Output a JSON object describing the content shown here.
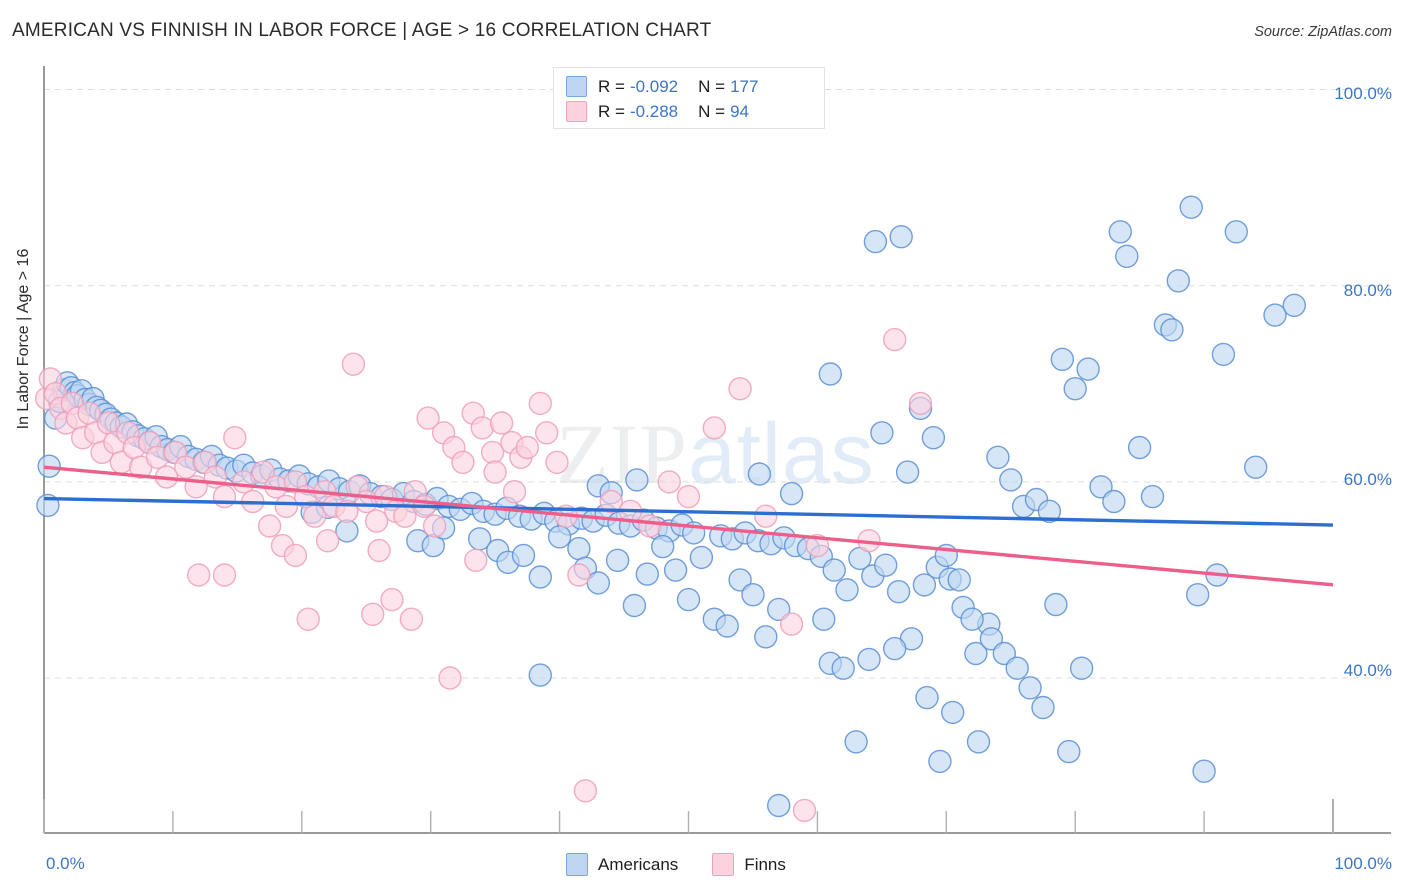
{
  "header": {
    "title": "AMERICAN VS FINNISH IN LABOR FORCE | AGE > 16 CORRELATION CHART",
    "source": "Source: ZipAtlas.com"
  },
  "watermark": {
    "part1": "ZIP",
    "part2": "atlas"
  },
  "correlation_legend": {
    "rows": [
      {
        "series": "Americans",
        "r_label": "R =",
        "r_value": "-0.092",
        "n_label": "N =",
        "n_value": "177",
        "color": "#bed6f2"
      },
      {
        "series": "Finns",
        "r_label": "R =",
        "r_value": "-0.288",
        "n_label": "N =",
        "n_value": "94",
        "color": "#fbd2de"
      }
    ]
  },
  "bottom_legend": {
    "items": [
      {
        "label": "Americans",
        "fill": "#bed6f2",
        "stroke": "#7aa7db"
      },
      {
        "label": "Finns",
        "fill": "#fbd2de",
        "stroke": "#eda3bb"
      }
    ]
  },
  "axes": {
    "y_title": "In Labor Force | Age > 16",
    "y_ticks": [
      "100.0%",
      "80.0%",
      "60.0%",
      "40.0%"
    ],
    "x_min_label": "0.0%",
    "x_max_label": "100.0%"
  },
  "chart_data": {
    "type": "scatter",
    "title": "AMERICAN VS FINNISH IN LABOR FORCE | AGE > 16 CORRELATION CHART",
    "xlabel": "",
    "ylabel": "In Labor Force | Age > 16",
    "xlim": [
      0,
      100
    ],
    "ylim": [
      24.2,
      102.4
    ],
    "x_ticks": [
      0,
      100
    ],
    "y_ticks": [
      40,
      60,
      80,
      100
    ],
    "grid": true,
    "legend_position": "bottom",
    "colors": {
      "americans_fill": "#bed6f2",
      "americans_stroke": "#5b8fd4",
      "finns_fill": "#fbd2de",
      "finns_stroke": "#ef9fba",
      "americans_trend": "#2c6fd1",
      "finns_trend": "#ec5f8b",
      "axis_text": "#3b76c4",
      "grid": "#dddddd"
    },
    "series": [
      {
        "name": "Americans",
        "r": -0.092,
        "n": 177,
        "trendline": {
          "x0": 0,
          "y0": 58.3,
          "x1": 100,
          "y1": 55.6
        },
        "points": [
          [
            0.3,
            57.6
          ],
          [
            0.4,
            61.6
          ],
          [
            0.9,
            66.5
          ],
          [
            1.2,
            68.2
          ],
          [
            1.5,
            69.4
          ],
          [
            1.8,
            70.1
          ],
          [
            2.1,
            69.6
          ],
          [
            2.4,
            69.1
          ],
          [
            2.6,
            68.8
          ],
          [
            2.9,
            69.3
          ],
          [
            3.2,
            68.4
          ],
          [
            3.5,
            67.9
          ],
          [
            3.8,
            68.5
          ],
          [
            4.1,
            67.6
          ],
          [
            4.4,
            67.3
          ],
          [
            4.8,
            66.9
          ],
          [
            5.2,
            66.4
          ],
          [
            5.6,
            66.0
          ],
          [
            6.0,
            65.6
          ],
          [
            6.4,
            65.9
          ],
          [
            6.9,
            65.1
          ],
          [
            7.3,
            64.7
          ],
          [
            7.8,
            64.4
          ],
          [
            8.2,
            64.0
          ],
          [
            8.7,
            64.6
          ],
          [
            9.1,
            63.6
          ],
          [
            9.6,
            63.3
          ],
          [
            10.1,
            63.0
          ],
          [
            10.6,
            63.6
          ],
          [
            11.2,
            62.6
          ],
          [
            11.8,
            62.3
          ],
          [
            12.4,
            62.0
          ],
          [
            13.0,
            62.6
          ],
          [
            13.6,
            61.7
          ],
          [
            14.2,
            61.4
          ],
          [
            14.9,
            61.1
          ],
          [
            15.5,
            61.7
          ],
          [
            16.2,
            60.9
          ],
          [
            16.9,
            60.6
          ],
          [
            17.6,
            61.2
          ],
          [
            18.3,
            60.3
          ],
          [
            19.0,
            60.1
          ],
          [
            19.8,
            60.6
          ],
          [
            20.5,
            59.8
          ],
          [
            21.3,
            59.5
          ],
          [
            22.1,
            60.1
          ],
          [
            22.9,
            59.3
          ],
          [
            23.7,
            59.0
          ],
          [
            24.5,
            59.6
          ],
          [
            25.3,
            58.8
          ],
          [
            20.8,
            56.9
          ],
          [
            22.0,
            57.4
          ],
          [
            23.5,
            55.0
          ],
          [
            26.2,
            58.5
          ],
          [
            27.0,
            58.2
          ],
          [
            27.9,
            58.8
          ],
          [
            28.7,
            58.0
          ],
          [
            29.6,
            57.7
          ],
          [
            30.5,
            58.3
          ],
          [
            31.4,
            57.5
          ],
          [
            32.3,
            57.2
          ],
          [
            33.2,
            57.8
          ],
          [
            34.1,
            57.0
          ],
          [
            35.0,
            56.7
          ],
          [
            35.9,
            57.3
          ],
          [
            36.9,
            56.5
          ],
          [
            37.8,
            56.2
          ],
          [
            38.8,
            56.8
          ],
          [
            39.7,
            56.0
          ],
          [
            40.7,
            55.7
          ],
          [
            29.0,
            54.0
          ],
          [
            30.2,
            53.5
          ],
          [
            31.0,
            55.3
          ],
          [
            33.8,
            54.2
          ],
          [
            35.2,
            53.0
          ],
          [
            36.0,
            51.8
          ],
          [
            37.2,
            52.5
          ],
          [
            38.5,
            50.3
          ],
          [
            40.0,
            54.4
          ],
          [
            41.5,
            53.2
          ],
          [
            41.7,
            56.3
          ],
          [
            42.6,
            56.0
          ],
          [
            43.6,
            56.6
          ],
          [
            44.6,
            55.8
          ],
          [
            45.5,
            55.5
          ],
          [
            46.5,
            56.1
          ],
          [
            47.5,
            55.3
          ],
          [
            48.5,
            55.0
          ],
          [
            49.5,
            55.6
          ],
          [
            50.4,
            54.8
          ],
          [
            42.0,
            51.2
          ],
          [
            43.0,
            49.7
          ],
          [
            44.5,
            52.0
          ],
          [
            45.8,
            47.4
          ],
          [
            46.8,
            50.6
          ],
          [
            48.0,
            53.4
          ],
          [
            49.0,
            51.0
          ],
          [
            50.0,
            48.0
          ],
          [
            51.0,
            52.3
          ],
          [
            52.0,
            46.0
          ],
          [
            38.5,
            40.3
          ],
          [
            43.0,
            59.6
          ],
          [
            44.0,
            58.9
          ],
          [
            46.0,
            60.2
          ],
          [
            52.5,
            54.5
          ],
          [
            53.4,
            54.2
          ],
          [
            54.4,
            54.8
          ],
          [
            55.4,
            54.0
          ],
          [
            56.4,
            53.7
          ],
          [
            57.4,
            54.3
          ],
          [
            53.0,
            45.3
          ],
          [
            54.0,
            50.0
          ],
          [
            55.0,
            48.5
          ],
          [
            56.0,
            44.2
          ],
          [
            57.0,
            47.0
          ],
          [
            58.3,
            53.5
          ],
          [
            59.3,
            53.2
          ],
          [
            60.3,
            52.4
          ],
          [
            61.3,
            51.0
          ],
          [
            62.3,
            49.0
          ],
          [
            55.5,
            60.8
          ],
          [
            58.0,
            58.8
          ],
          [
            60.5,
            46.0
          ],
          [
            61.0,
            41.5
          ],
          [
            62.0,
            41.0
          ],
          [
            63.3,
            52.2
          ],
          [
            64.3,
            50.4
          ],
          [
            65.3,
            51.5
          ],
          [
            66.3,
            48.8
          ],
          [
            67.3,
            44.0
          ],
          [
            57.0,
            27.0
          ],
          [
            63.0,
            33.5
          ],
          [
            64.0,
            41.9
          ],
          [
            66.0,
            43.0
          ],
          [
            68.3,
            49.5
          ],
          [
            69.3,
            51.3
          ],
          [
            70.3,
            50.1
          ],
          [
            71.3,
            47.2
          ],
          [
            72.3,
            42.5
          ],
          [
            73.3,
            45.5
          ],
          [
            61.0,
            71.0
          ],
          [
            64.5,
            84.5
          ],
          [
            66.5,
            85.0
          ],
          [
            65.0,
            65.0
          ],
          [
            67.0,
            61.0
          ],
          [
            68.0,
            67.5
          ],
          [
            69.0,
            64.5
          ],
          [
            70.0,
            52.5
          ],
          [
            71.0,
            50.0
          ],
          [
            72.0,
            46.0
          ],
          [
            68.5,
            38.0
          ],
          [
            69.5,
            31.5
          ],
          [
            70.5,
            36.5
          ],
          [
            72.5,
            33.5
          ],
          [
            73.5,
            44.0
          ],
          [
            74.0,
            62.5
          ],
          [
            75.0,
            60.2
          ],
          [
            76.0,
            57.5
          ],
          [
            77.0,
            58.2
          ],
          [
            78.0,
            57.0
          ],
          [
            74.5,
            42.5
          ],
          [
            75.5,
            41.0
          ],
          [
            76.5,
            39.0
          ],
          [
            77.5,
            37.0
          ],
          [
            78.5,
            47.5
          ],
          [
            79.0,
            72.5
          ],
          [
            80.0,
            69.5
          ],
          [
            81.0,
            71.5
          ],
          [
            82.0,
            59.5
          ],
          [
            83.0,
            58.0
          ],
          [
            79.5,
            32.5
          ],
          [
            80.5,
            41.0
          ],
          [
            83.5,
            85.5
          ],
          [
            84.0,
            83.0
          ],
          [
            85.0,
            63.5
          ],
          [
            86.0,
            58.5
          ],
          [
            87.0,
            76.0
          ],
          [
            87.5,
            75.5
          ],
          [
            88.0,
            80.5
          ],
          [
            89.0,
            88.0
          ],
          [
            90.0,
            30.5
          ],
          [
            91.0,
            50.5
          ],
          [
            91.5,
            73.0
          ],
          [
            92.5,
            85.5
          ],
          [
            94.0,
            61.5
          ],
          [
            95.5,
            77.0
          ],
          [
            97.0,
            78.0
          ],
          [
            89.5,
            48.5
          ]
        ]
      },
      {
        "name": "Finns",
        "r": -0.288,
        "n": 94,
        "trendline": {
          "x0": 0,
          "y0": 61.5,
          "x1": 100,
          "y1": 49.5
        },
        "points": [
          [
            0.2,
            68.5
          ],
          [
            0.5,
            70.5
          ],
          [
            0.9,
            69.0
          ],
          [
            1.3,
            67.5
          ],
          [
            1.7,
            66.0
          ],
          [
            2.2,
            68.0
          ],
          [
            2.6,
            66.5
          ],
          [
            3.0,
            64.5
          ],
          [
            3.5,
            67.0
          ],
          [
            4.0,
            65.0
          ],
          [
            4.5,
            63.0
          ],
          [
            5.0,
            66.0
          ],
          [
            5.5,
            64.0
          ],
          [
            6.0,
            62.0
          ],
          [
            6.5,
            65.0
          ],
          [
            7.0,
            63.5
          ],
          [
            7.5,
            61.5
          ],
          [
            8.2,
            64.0
          ],
          [
            8.8,
            62.5
          ],
          [
            9.5,
            60.5
          ],
          [
            10.2,
            63.0
          ],
          [
            11.0,
            61.5
          ],
          [
            11.8,
            59.5
          ],
          [
            12.5,
            62.0
          ],
          [
            13.3,
            60.5
          ],
          [
            14.0,
            58.5
          ],
          [
            14.8,
            64.5
          ],
          [
            15.5,
            60.0
          ],
          [
            16.2,
            58.0
          ],
          [
            17.0,
            61.0
          ],
          [
            12.0,
            50.5
          ],
          [
            14.0,
            50.5
          ],
          [
            17.5,
            55.5
          ],
          [
            18.0,
            59.5
          ],
          [
            18.8,
            57.5
          ],
          [
            19.5,
            60.0
          ],
          [
            20.3,
            58.5
          ],
          [
            21.0,
            56.5
          ],
          [
            21.8,
            59.0
          ],
          [
            22.5,
            57.5
          ],
          [
            18.5,
            53.5
          ],
          [
            19.5,
            52.5
          ],
          [
            20.5,
            46.0
          ],
          [
            22.0,
            54.0
          ],
          [
            23.5,
            57.0
          ],
          [
            24.3,
            59.5
          ],
          [
            25.0,
            58.0
          ],
          [
            25.8,
            56.0
          ],
          [
            26.5,
            58.5
          ],
          [
            27.3,
            57.0
          ],
          [
            24.0,
            72.0
          ],
          [
            25.5,
            46.5
          ],
          [
            26.0,
            53.0
          ],
          [
            27.0,
            48.0
          ],
          [
            28.0,
            56.5
          ],
          [
            28.8,
            59.0
          ],
          [
            29.5,
            57.5
          ],
          [
            30.3,
            55.5
          ],
          [
            31.0,
            65.0
          ],
          [
            31.8,
            63.5
          ],
          [
            28.5,
            46.0
          ],
          [
            29.8,
            66.5
          ],
          [
            31.5,
            40.0
          ],
          [
            32.5,
            62.0
          ],
          [
            33.3,
            67.0
          ],
          [
            34.0,
            65.5
          ],
          [
            34.8,
            63.0
          ],
          [
            35.5,
            66.0
          ],
          [
            36.3,
            64.0
          ],
          [
            37.0,
            62.5
          ],
          [
            33.5,
            52.0
          ],
          [
            35.0,
            61.0
          ],
          [
            36.5,
            59.0
          ],
          [
            37.5,
            63.5
          ],
          [
            38.5,
            68.0
          ],
          [
            39.0,
            65.0
          ],
          [
            39.8,
            62.0
          ],
          [
            40.5,
            56.5
          ],
          [
            41.5,
            50.5
          ],
          [
            42.0,
            28.5
          ],
          [
            44.0,
            58.0
          ],
          [
            45.5,
            57.0
          ],
          [
            47.0,
            55.5
          ],
          [
            48.5,
            60.0
          ],
          [
            50.0,
            58.5
          ],
          [
            52.0,
            65.5
          ],
          [
            54.0,
            69.5
          ],
          [
            56.0,
            56.5
          ],
          [
            58.0,
            45.5
          ],
          [
            59.0,
            26.5
          ],
          [
            60.0,
            53.5
          ],
          [
            64.0,
            54.0
          ],
          [
            68.0,
            68.0
          ],
          [
            66.0,
            74.5
          ]
        ]
      }
    ]
  }
}
